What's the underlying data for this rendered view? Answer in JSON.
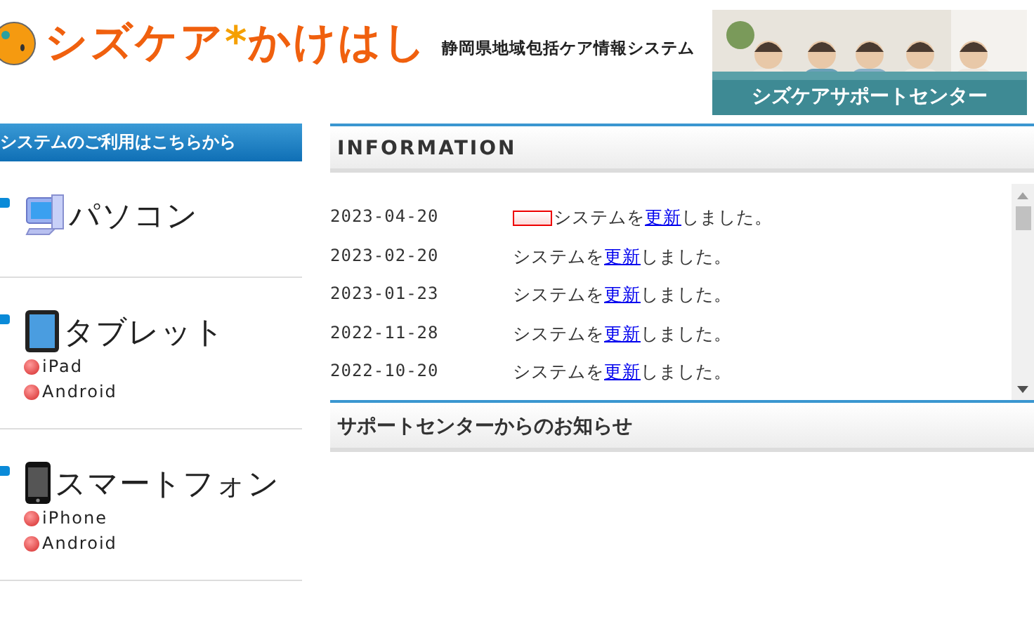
{
  "header": {
    "logo_text": "シズケア",
    "logo_mark": "*",
    "logo_text2": "かけはし",
    "subtitle": "静岡県地域包括ケア情報システム",
    "banner": {
      "kind": "picture",
      "caption": "シズケアサポートセンター"
    }
  },
  "sidebar": {
    "title": "システムのご利用はこちらから",
    "devices": [
      {
        "kind": "pc",
        "label": "パソコン"
      },
      {
        "kind": "tablet",
        "label": "タブレット",
        "links": [
          "iPad",
          "Android"
        ]
      },
      {
        "kind": "phone",
        "label": "スマートフォン",
        "links": [
          "iPhone",
          "Android"
        ]
      }
    ]
  },
  "information": {
    "title": "INFORMATION",
    "items": [
      {
        "date": "2023-04-20",
        "new": true,
        "before": "システムを",
        "link": "更新",
        "after": "しました。"
      },
      {
        "date": "2023-02-20",
        "new": false,
        "before": "システムを",
        "link": "更新",
        "after": "しました。"
      },
      {
        "date": "2023-01-23",
        "new": false,
        "before": "システムを",
        "link": "更新",
        "after": "しました。"
      },
      {
        "date": "2022-11-28",
        "new": false,
        "before": "システムを",
        "link": "更新",
        "after": "しました。"
      },
      {
        "date": "2022-10-20",
        "new": false,
        "before": "システムを",
        "link": "更新",
        "after": "しました。"
      }
    ]
  },
  "support": {
    "title": "サポートセンターからのお知らせ"
  }
}
